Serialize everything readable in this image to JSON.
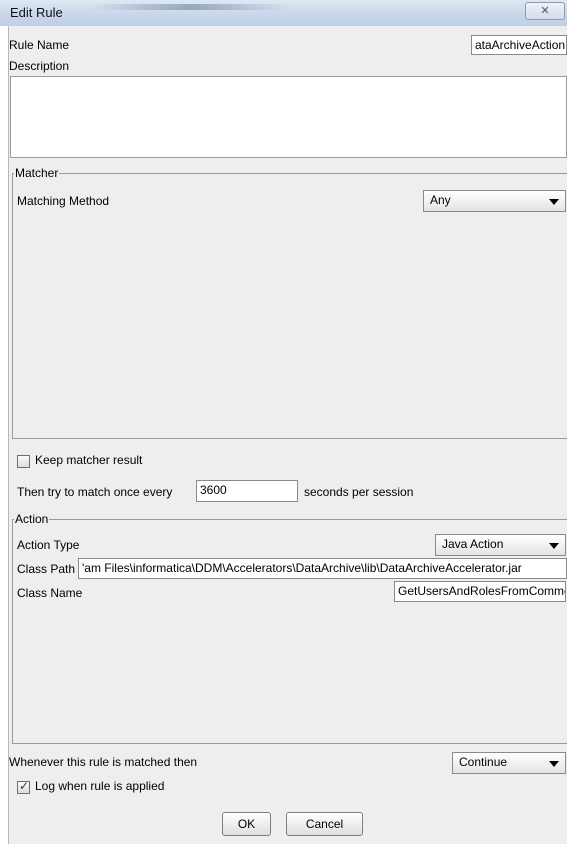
{
  "window": {
    "title": "Edit Rule",
    "close_glyph": "✕"
  },
  "rule_name": {
    "label": "Rule Name",
    "value": "ataArchiveAction"
  },
  "description": {
    "label": "Description",
    "value": ""
  },
  "matcher": {
    "group_title": "Matcher",
    "method_label": "Matching Method",
    "method_value": "Any"
  },
  "keep_matcher": {
    "label": "Keep matcher result",
    "checked": false
  },
  "match_interval": {
    "prefix": "Then try to match once every",
    "value": "3600",
    "suffix": "seconds per session"
  },
  "action": {
    "group_title": "Action",
    "type_label": "Action Type",
    "type_value": "Java Action",
    "class_path_label": "Class Path",
    "class_path_value": "'am Files\\informatica\\DDM\\Accelerators\\DataArchive\\lib\\DataArchiveAccelerator.jar",
    "class_name_label": "Class Name",
    "class_name_value": "GetUsersAndRolesFromComment"
  },
  "on_match": {
    "label": "Whenever this rule is matched then",
    "value": "Continue"
  },
  "log_applied": {
    "label": "Log when rule is applied",
    "checked": true,
    "check_glyph": "✓"
  },
  "buttons": {
    "ok": "OK",
    "cancel": "Cancel"
  },
  "icons": {
    "dropdown": "chevron-down-icon",
    "close": "close-icon",
    "check": "checkmark-icon"
  }
}
